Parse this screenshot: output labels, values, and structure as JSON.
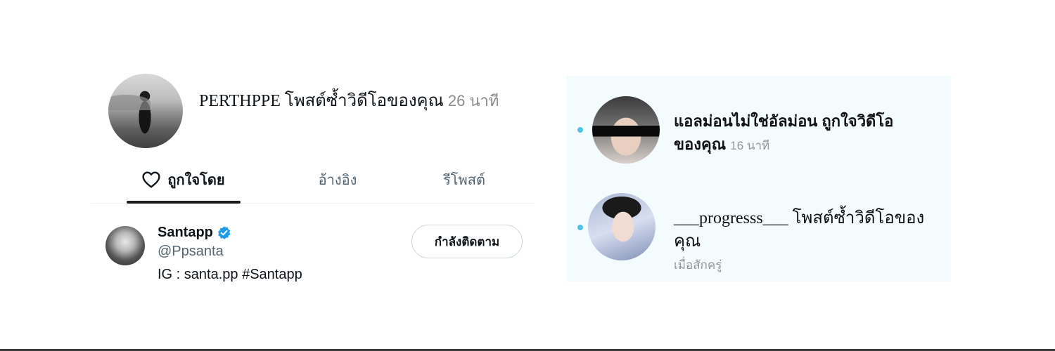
{
  "notification": {
    "text": "PERTHPPE โพสต์ซ้ำวิดีโอของคุณ",
    "time": "26 นาที"
  },
  "tabs": [
    {
      "label": "ถูกใจโดย",
      "active": true
    },
    {
      "label": "อ้างอิง",
      "active": false
    },
    {
      "label": "รีโพสต์",
      "active": false
    }
  ],
  "user": {
    "name": "Santapp",
    "handle": "@Ppsanta",
    "bio": "IG : santa.pp #Santapp",
    "follow_label": "กำลังติดตาม"
  },
  "activities": [
    {
      "text": "แอลม่อนไม่ใช่อัลม่อน ถูกใจวิดีโอของคุณ",
      "time": "16 นาที"
    },
    {
      "text": "___progresss___ โพสต์ซ้ำวิดีโอของคุณ",
      "time": "เมื่อสักครู่"
    }
  ],
  "colors": {
    "accent_blue": "#1d9bf0",
    "activity_dot": "#4fc3e8",
    "activity_bg": "#f4fbfd"
  }
}
